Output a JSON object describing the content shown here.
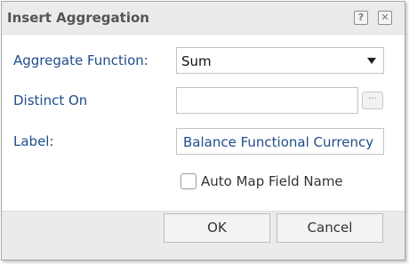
{
  "dialog": {
    "title": "Insert Aggregation",
    "help_glyph": "?",
    "close_glyph": "✕"
  },
  "fields": {
    "aggregate_function": {
      "label": "Aggregate Function:",
      "selected_value": "Sum"
    },
    "distinct_on": {
      "label": "Distinct On",
      "value": "",
      "browse_label": "···"
    },
    "label": {
      "label": "Label:",
      "value": "Balance Functional Currency"
    },
    "auto_map": {
      "label": "Auto Map Field Name",
      "checked": false
    }
  },
  "footer": {
    "ok_label": "OK",
    "cancel_label": "Cancel"
  },
  "colors": {
    "label_blue": "#1f4e8a",
    "title_gray": "#555555",
    "panel_gray": "#ebebeb"
  }
}
